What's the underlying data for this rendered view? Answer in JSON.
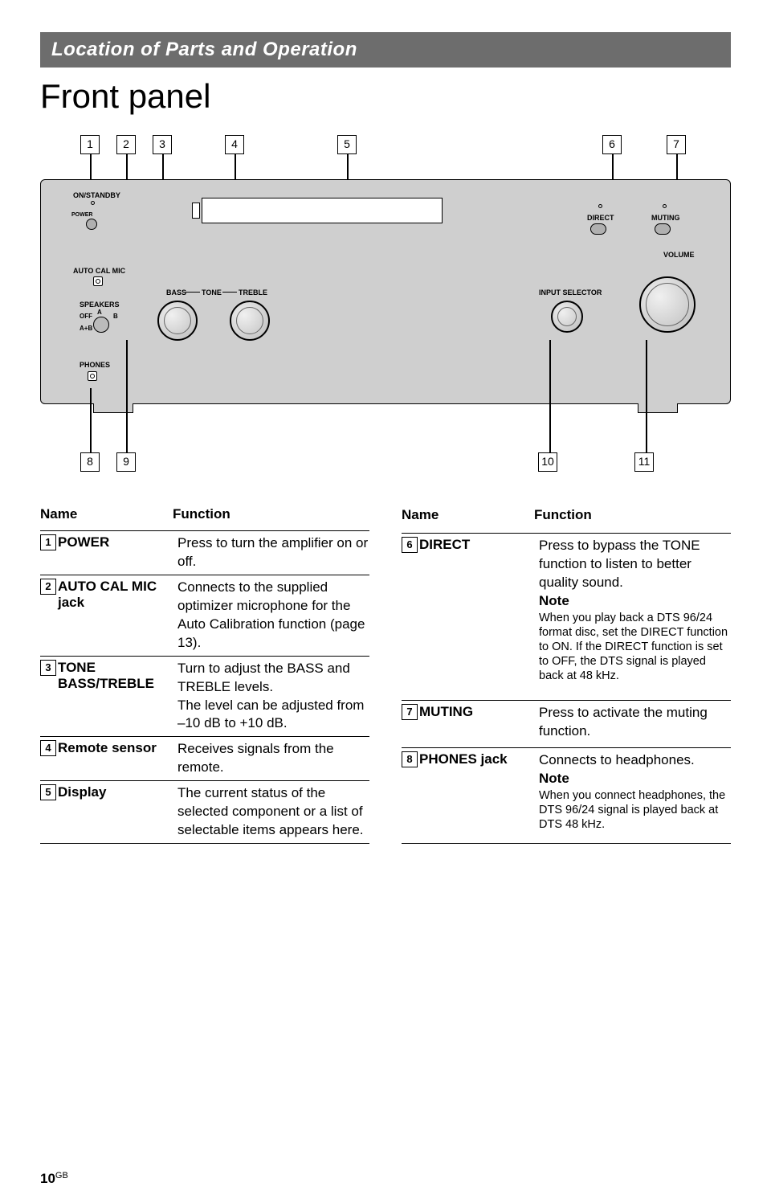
{
  "header": {
    "section": "Location of Parts and Operation",
    "title": "Front panel"
  },
  "panel_labels": {
    "on_standby": "ON/STANDBY",
    "power": "POWER",
    "auto_cal_mic": "AUTO CAL MIC",
    "speakers": "SPEAKERS",
    "off": "OFF",
    "a": "A",
    "b": "B",
    "ab": "A+B",
    "phones": "PHONES",
    "bass": "BASS",
    "tone": "TONE",
    "treble": "TREBLE",
    "direct": "DIRECT",
    "muting": "MUTING",
    "volume": "VOLUME",
    "input_selector": "INPUT SELECTOR"
  },
  "callouts": [
    "1",
    "2",
    "3",
    "4",
    "5",
    "6",
    "7",
    "8",
    "9",
    "10",
    "11"
  ],
  "tables": {
    "left": {
      "header_name": "Name",
      "header_fn": "Function",
      "rows": [
        {
          "num": "1",
          "name": "POWER",
          "fn": "Press to turn the amplifier on or off."
        },
        {
          "num": "2",
          "name": "AUTO CAL MIC jack",
          "fn": "Connects to the supplied optimizer microphone for the Auto Calibration function (page 13)."
        },
        {
          "num": "3",
          "name": "TONE BASS/TREBLE",
          "fn": "Turn to adjust the BASS and TREBLE levels.\nThe level can be adjusted from –10 dB to +10 dB."
        },
        {
          "num": "4",
          "name": "Remote sensor",
          "fn": "Receives signals from the remote."
        },
        {
          "num": "5",
          "name": "Display",
          "fn": "The current status of the selected component or a list of selectable items appears here."
        }
      ]
    },
    "right": {
      "header_name": "Name",
      "header_fn": "Function",
      "rows": [
        {
          "num": "6",
          "name": "DIRECT",
          "fn": "Press to bypass the TONE function to listen to better quality sound.",
          "note_label": "Note",
          "note": "When you play back a DTS 96/24 format disc, set the DIRECT function to ON. If the DIRECT function is set to OFF, the DTS signal is played back at 48 kHz."
        },
        {
          "num": "7",
          "name": "MUTING",
          "fn": "Press to activate the muting function."
        },
        {
          "num": "8",
          "name": "PHONES jack",
          "fn": "Connects to headphones.",
          "note_label": "Note",
          "note": "When you connect headphones, the DTS 96/24 signal is played back at DTS 48 kHz."
        }
      ]
    }
  },
  "page_number": {
    "num": "10",
    "suffix": "GB"
  }
}
